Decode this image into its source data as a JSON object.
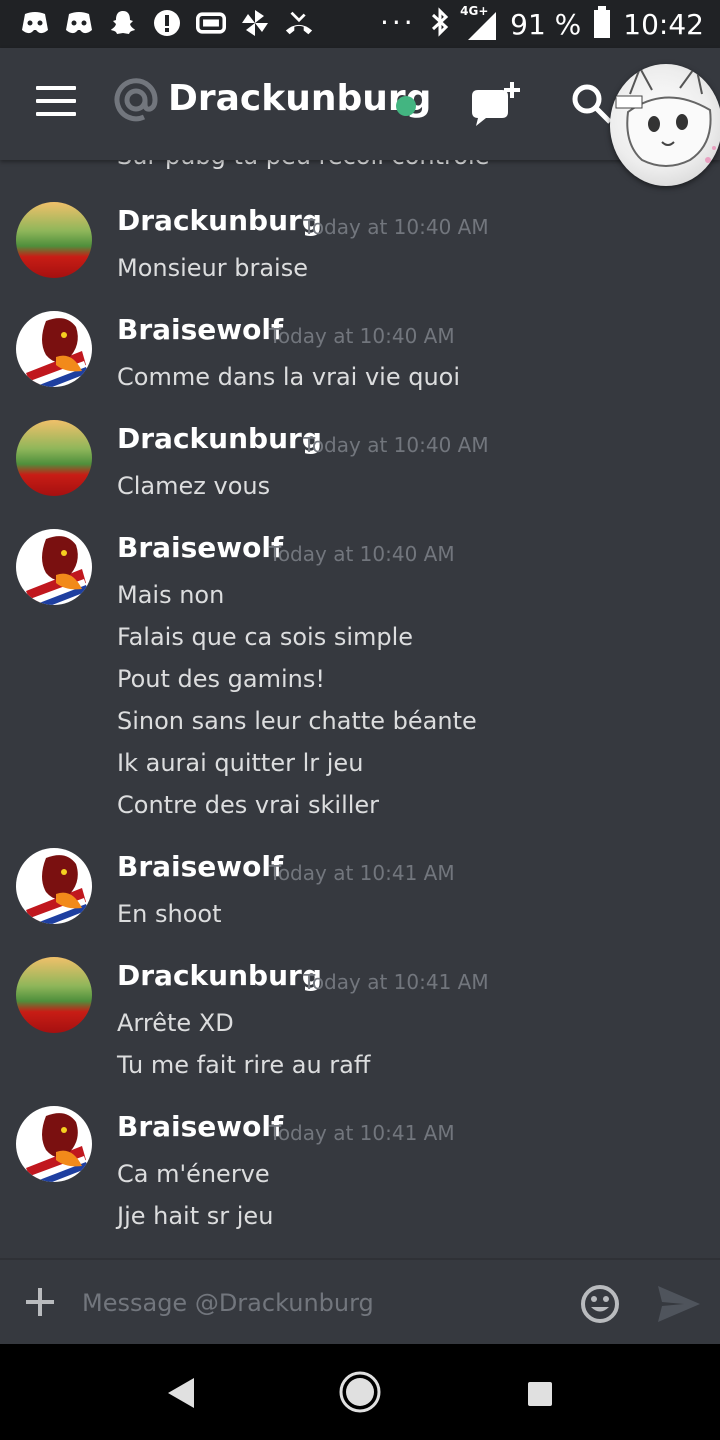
{
  "status_bar": {
    "network": "4G+",
    "battery": "91 %",
    "time": "10:42"
  },
  "header": {
    "title": "Drackunburg",
    "status": "online"
  },
  "clipped_message": "Sur pubg tu peu recoil controle",
  "messages": [
    {
      "author": "Drackunburg",
      "time": "Today at 10:40 AM",
      "lines": [
        "Monsieur braise"
      ]
    },
    {
      "author": "Braisewolf",
      "time": "Today at 10:40 AM",
      "lines": [
        "Comme dans la vrai vie quoi"
      ]
    },
    {
      "author": "Drackunburg",
      "time": "Today at 10:40 AM",
      "lines": [
        "Clamez vous"
      ]
    },
    {
      "author": "Braisewolf",
      "time": "Today at 10:40 AM",
      "lines": [
        "Mais non",
        "Falais que ca sois simple",
        "Pout des gamins!",
        "Sinon sans leur chatte béante",
        "Ik aurai quitter lr jeu",
        "Contre des vrai skiller"
      ]
    },
    {
      "author": "Braisewolf",
      "time": "Today at 10:41 AM",
      "lines": [
        "En shoot"
      ]
    },
    {
      "author": "Drackunburg",
      "time": "Today at 10:41 AM",
      "lines": [
        "Arrête XD",
        "Tu me fait rire au raff"
      ]
    },
    {
      "author": "Braisewolf",
      "time": "Today at 10:41 AM",
      "lines": [
        "Ca m'énerve",
        "Jje hait sr jeu"
      ]
    }
  ],
  "composer": {
    "placeholder": "Message @Drackunburg"
  },
  "colors": {
    "background": "#36393f",
    "status_bar": "#202225",
    "online": "#43b581",
    "muted": "#72767d"
  }
}
